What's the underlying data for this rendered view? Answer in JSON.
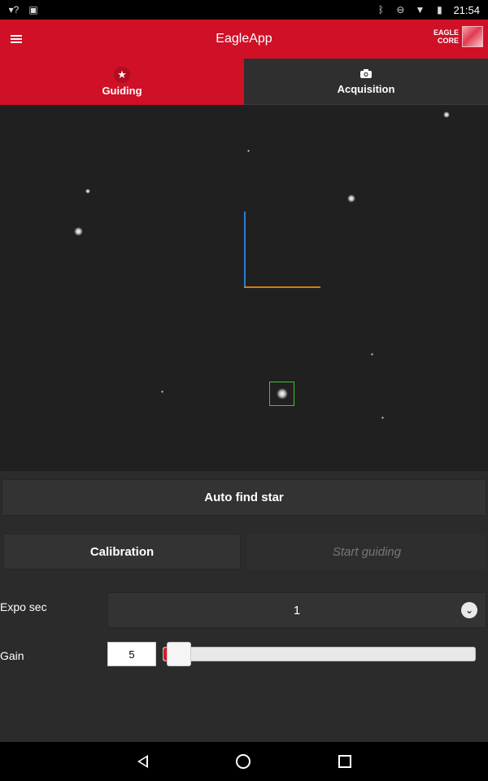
{
  "status_bar": {
    "time": "21:54",
    "icons": [
      "wifi-question-icon",
      "image-icon",
      "bluetooth-icon",
      "do-not-disturb-icon",
      "wifi-icon",
      "battery-icon"
    ]
  },
  "app_bar": {
    "title": "EagleApp",
    "brand_line1": "EAGLE",
    "brand_line2": "CORE",
    "accent_color": "#cf1027"
  },
  "tabs": [
    {
      "label": "Guiding",
      "icon": "star-icon",
      "active": true
    },
    {
      "label": "Acquisition",
      "icon": "camera-icon",
      "active": false
    }
  ],
  "viewer": {
    "axis_colors": {
      "y": "#2b7fd6",
      "x": "#d57a1c"
    },
    "target_color": "#35c92e"
  },
  "actions": {
    "auto_find_star": "Auto find star",
    "calibration": "Calibration",
    "start_guiding": "Start guiding"
  },
  "settings": {
    "expo_label": "Expo sec",
    "expo_value": "1",
    "gain_label": "Gain",
    "gain_value": "5",
    "gain_fraction": 0.0
  },
  "nav_bar": {
    "icons": [
      "back-icon",
      "home-icon",
      "recent-apps-icon"
    ]
  }
}
